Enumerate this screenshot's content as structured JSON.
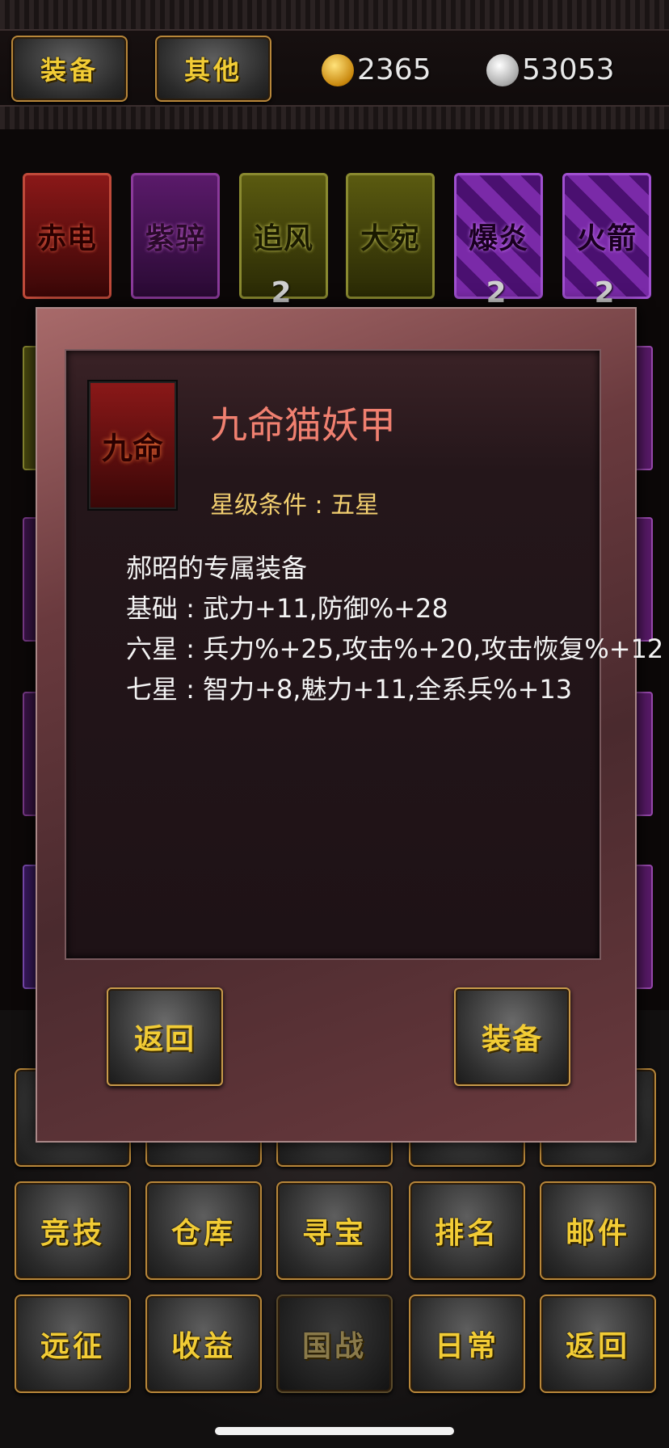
{
  "top_tabs": {
    "equip": "装备",
    "other": "其他"
  },
  "currency": {
    "gold": "2365",
    "silver": "53053",
    "gold_icon": "gold-ingot-icon",
    "silver_icon": "silver-ingot-icon"
  },
  "items_row": [
    {
      "name": "赤电",
      "count": ""
    },
    {
      "name": "紫骍",
      "count": ""
    },
    {
      "name": "追风",
      "count": "2"
    },
    {
      "name": "大宛",
      "count": ""
    },
    {
      "name": "爆炎",
      "count": "2"
    },
    {
      "name": "火箭",
      "count": "2"
    }
  ],
  "dialog": {
    "icon_text": "九命",
    "title": "九命猫妖甲",
    "star_requirement": "星级条件 : 五星",
    "lines": [
      "郝昭的专属装备",
      "基础 : 武力+11,防御%+28",
      "六星 : 兵力%+25,攻击%+20,攻击恢复%+12",
      "七星 : 智力+8,魅力+11,全系兵%+13"
    ],
    "back_button": "返回",
    "equip_button": "装备"
  },
  "bottom_menu": {
    "row2": [
      "竞技",
      "仓库",
      "寻宝",
      "排名",
      "邮件"
    ],
    "row3": [
      "远征",
      "收益",
      "国战",
      "日常",
      "返回"
    ]
  }
}
